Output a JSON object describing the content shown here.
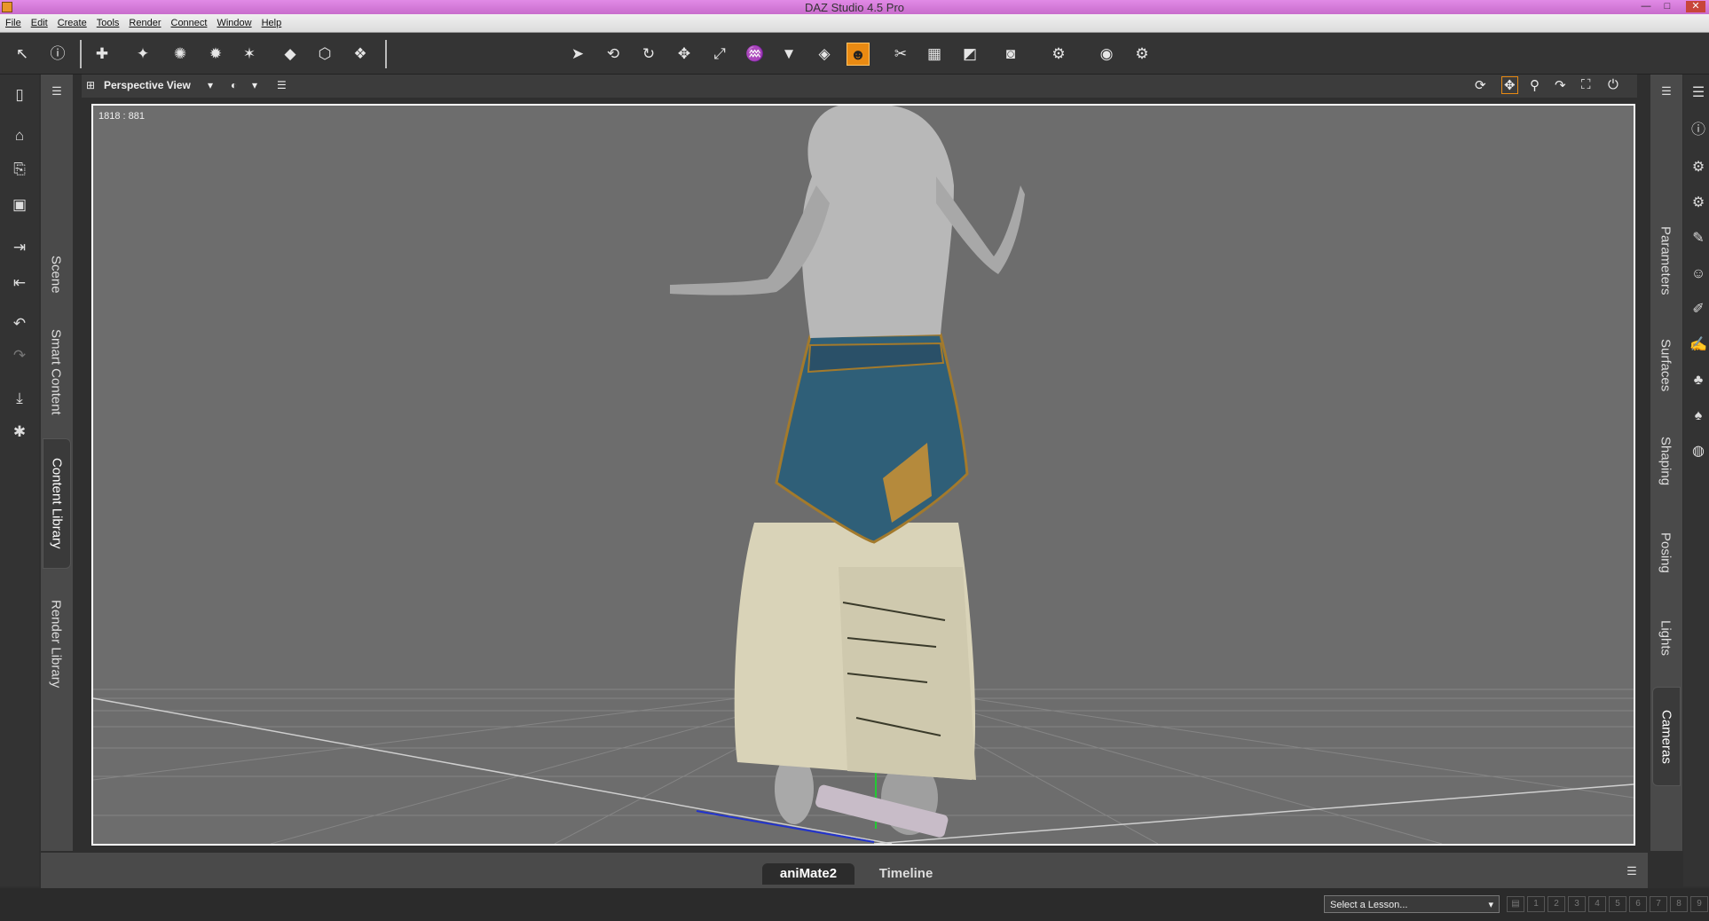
{
  "app": {
    "title": "DAZ Studio 4.5 Pro"
  },
  "window_controls": {
    "minimize": "—",
    "maximize": "□",
    "close": "✕"
  },
  "menus": [
    "File",
    "Edit",
    "Create",
    "Tools",
    "Render",
    "Connect",
    "Window",
    "Help"
  ],
  "toolbar": {
    "icons": [
      "whats-this-icon",
      "help-icon",
      "new-figure-icon",
      "spotlight-icon",
      "point-light-icon",
      "distant-light-icon",
      "linear-point-light-icon",
      "primitive-icon",
      "cube-icon",
      "grouping-icon",
      "node-selection-icon",
      "rotate-universal-icon",
      "rotate-icon",
      "translate-icon",
      "scale-icon",
      "joint-editor-icon",
      "geometry-editor-icon",
      "surface-selection-icon",
      "active-pose-icon",
      "transfer-icon",
      "uv-editor-icon",
      "weight-map-icon",
      "render-icon",
      "render-settings-icon",
      "camera-icon",
      "render-settings-gear-icon"
    ],
    "active": "active-pose-icon"
  },
  "left_tabs": [
    "Scene",
    "Smart Content",
    "Content Library",
    "Render Library"
  ],
  "left_tab_selected": "Content Library",
  "right_tabs": [
    "Parameters",
    "Surfaces",
    "Shaping",
    "Posing",
    "Lights",
    "Cameras"
  ],
  "right_tab_selected": "Cameras",
  "viewport": {
    "view_name": "Perspective View",
    "dimensions": "1818 : 881",
    "background": "#6d6d6d"
  },
  "bottom_tabs": [
    "aniMate2",
    "Timeline"
  ],
  "bottom_tab_selected": "aniMate2",
  "status": {
    "lesson_placeholder": "Select a Lesson...",
    "steps": [
      "1",
      "2",
      "3",
      "4",
      "5",
      "6",
      "7",
      "8",
      "9"
    ]
  },
  "colors": {
    "accent": "#e98a12",
    "skirt_blue": "#2f5f78",
    "skirt_cream": "#d9d3b8"
  }
}
